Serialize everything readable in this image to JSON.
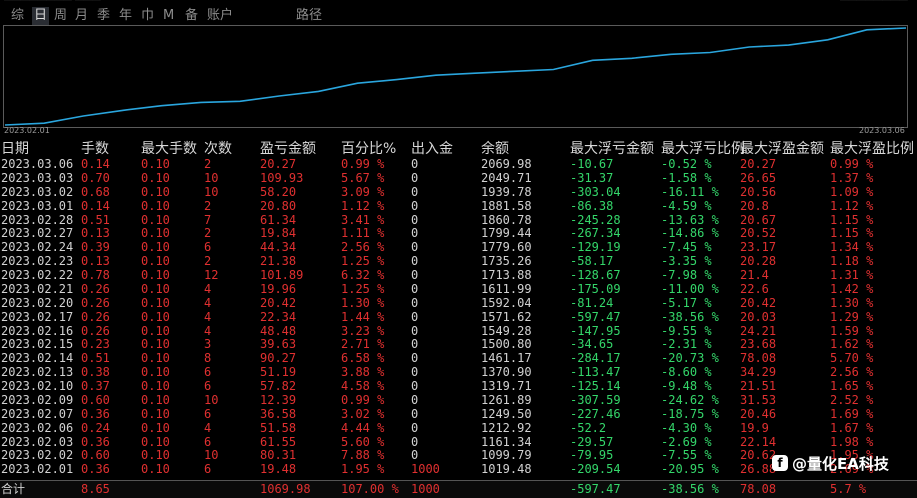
{
  "tabs": {
    "items": [
      "综",
      "日",
      "周",
      "月",
      "季",
      "年",
      "巾",
      "M",
      "备",
      "账户",
      "路径"
    ],
    "active_index": 1
  },
  "chart": {
    "start_date": "2023.02.01",
    "end_date": "2023.03.06",
    "line_color": "#2aa6de"
  },
  "columns": [
    "日期",
    "手数",
    "最大手数",
    "次数",
    "盈亏金额",
    "百分比%",
    "出入金",
    "余额",
    "最大浮亏金额",
    "最大浮亏比例",
    "最大浮盈金额",
    "最大浮盈比例"
  ],
  "colors": {
    "red": "#e03030",
    "green": "#34d66a",
    "white": "#d2d2d2"
  },
  "rows": [
    {
      "date": "2023.03.06",
      "lots": "0.14",
      "max_lots": "0.10",
      "count": "2",
      "pnl": "20.27",
      "pct": "0.99 %",
      "io": "0",
      "balance": "2069.98",
      "max_float_loss": "-10.67",
      "max_float_loss_pct": "-0.52 %",
      "max_float_profit": "20.27",
      "max_float_profit_pct": "0.99 %"
    },
    {
      "date": "2023.03.03",
      "lots": "0.70",
      "max_lots": "0.10",
      "count": "10",
      "pnl": "109.93",
      "pct": "5.67 %",
      "io": "0",
      "balance": "2049.71",
      "max_float_loss": "-31.37",
      "max_float_loss_pct": "-1.58 %",
      "max_float_profit": "26.65",
      "max_float_profit_pct": "1.37 %"
    },
    {
      "date": "2023.03.02",
      "lots": "0.68",
      "max_lots": "0.10",
      "count": "10",
      "pnl": "58.20",
      "pct": "3.09 %",
      "io": "0",
      "balance": "1939.78",
      "max_float_loss": "-303.04",
      "max_float_loss_pct": "-16.11 %",
      "max_float_profit": "20.56",
      "max_float_profit_pct": "1.09 %"
    },
    {
      "date": "2023.03.01",
      "lots": "0.14",
      "max_lots": "0.10",
      "count": "2",
      "pnl": "20.80",
      "pct": "1.12 %",
      "io": "0",
      "balance": "1881.58",
      "max_float_loss": "-86.38",
      "max_float_loss_pct": "-4.59 %",
      "max_float_profit": "20.8",
      "max_float_profit_pct": "1.12 %"
    },
    {
      "date": "2023.02.28",
      "lots": "0.51",
      "max_lots": "0.10",
      "count": "7",
      "pnl": "61.34",
      "pct": "3.41 %",
      "io": "0",
      "balance": "1860.78",
      "max_float_loss": "-245.28",
      "max_float_loss_pct": "-13.63 %",
      "max_float_profit": "20.67",
      "max_float_profit_pct": "1.15 %"
    },
    {
      "date": "2023.02.27",
      "lots": "0.13",
      "max_lots": "0.10",
      "count": "2",
      "pnl": "19.84",
      "pct": "1.11 %",
      "io": "0",
      "balance": "1799.44",
      "max_float_loss": "-267.34",
      "max_float_loss_pct": "-14.86 %",
      "max_float_profit": "20.52",
      "max_float_profit_pct": "1.15 %"
    },
    {
      "date": "2023.02.24",
      "lots": "0.39",
      "max_lots": "0.10",
      "count": "6",
      "pnl": "44.34",
      "pct": "2.56 %",
      "io": "0",
      "balance": "1779.60",
      "max_float_loss": "-129.19",
      "max_float_loss_pct": "-7.45 %",
      "max_float_profit": "23.17",
      "max_float_profit_pct": "1.34 %"
    },
    {
      "date": "2023.02.23",
      "lots": "0.13",
      "max_lots": "0.10",
      "count": "2",
      "pnl": "21.38",
      "pct": "1.25 %",
      "io": "0",
      "balance": "1735.26",
      "max_float_loss": "-58.17",
      "max_float_loss_pct": "-3.35 %",
      "max_float_profit": "20.28",
      "max_float_profit_pct": "1.18 %"
    },
    {
      "date": "2023.02.22",
      "lots": "0.78",
      "max_lots": "0.10",
      "count": "12",
      "pnl": "101.89",
      "pct": "6.32 %",
      "io": "0",
      "balance": "1713.88",
      "max_float_loss": "-128.67",
      "max_float_loss_pct": "-7.98 %",
      "max_float_profit": "21.4",
      "max_float_profit_pct": "1.31 %"
    },
    {
      "date": "2023.02.21",
      "lots": "0.26",
      "max_lots": "0.10",
      "count": "4",
      "pnl": "19.96",
      "pct": "1.25 %",
      "io": "0",
      "balance": "1611.99",
      "max_float_loss": "-175.09",
      "max_float_loss_pct": "-11.00 %",
      "max_float_profit": "22.6",
      "max_float_profit_pct": "1.42 %"
    },
    {
      "date": "2023.02.20",
      "lots": "0.26",
      "max_lots": "0.10",
      "count": "4",
      "pnl": "20.42",
      "pct": "1.30 %",
      "io": "0",
      "balance": "1592.04",
      "max_float_loss": "-81.24",
      "max_float_loss_pct": "-5.17 %",
      "max_float_profit": "20.42",
      "max_float_profit_pct": "1.30 %"
    },
    {
      "date": "2023.02.17",
      "lots": "0.26",
      "max_lots": "0.10",
      "count": "4",
      "pnl": "22.34",
      "pct": "1.44 %",
      "io": "0",
      "balance": "1571.62",
      "max_float_loss": "-597.47",
      "max_float_loss_pct": "-38.56 %",
      "max_float_profit": "20.03",
      "max_float_profit_pct": "1.29 %"
    },
    {
      "date": "2023.02.16",
      "lots": "0.26",
      "max_lots": "0.10",
      "count": "4",
      "pnl": "48.48",
      "pct": "3.23 %",
      "io": "0",
      "balance": "1549.28",
      "max_float_loss": "-147.95",
      "max_float_loss_pct": "-9.55 %",
      "max_float_profit": "24.21",
      "max_float_profit_pct": "1.59 %"
    },
    {
      "date": "2023.02.15",
      "lots": "0.23",
      "max_lots": "0.10",
      "count": "3",
      "pnl": "39.63",
      "pct": "2.71 %",
      "io": "0",
      "balance": "1500.80",
      "max_float_loss": "-34.65",
      "max_float_loss_pct": "-2.31 %",
      "max_float_profit": "23.68",
      "max_float_profit_pct": "1.62 %"
    },
    {
      "date": "2023.02.14",
      "lots": "0.51",
      "max_lots": "0.10",
      "count": "8",
      "pnl": "90.27",
      "pct": "6.58 %",
      "io": "0",
      "balance": "1461.17",
      "max_float_loss": "-284.17",
      "max_float_loss_pct": "-20.73 %",
      "max_float_profit": "78.08",
      "max_float_profit_pct": "5.70 %"
    },
    {
      "date": "2023.02.13",
      "lots": "0.38",
      "max_lots": "0.10",
      "count": "6",
      "pnl": "51.19",
      "pct": "3.88 %",
      "io": "0",
      "balance": "1370.90",
      "max_float_loss": "-113.47",
      "max_float_loss_pct": "-8.60 %",
      "max_float_profit": "34.29",
      "max_float_profit_pct": "2.56 %"
    },
    {
      "date": "2023.02.10",
      "lots": "0.37",
      "max_lots": "0.10",
      "count": "6",
      "pnl": "57.82",
      "pct": "4.58 %",
      "io": "0",
      "balance": "1319.71",
      "max_float_loss": "-125.14",
      "max_float_loss_pct": "-9.48 %",
      "max_float_profit": "21.51",
      "max_float_profit_pct": "1.65 %"
    },
    {
      "date": "2023.02.09",
      "lots": "0.60",
      "max_lots": "0.10",
      "count": "10",
      "pnl": "12.39",
      "pct": "0.99 %",
      "io": "0",
      "balance": "1261.89",
      "max_float_loss": "-307.59",
      "max_float_loss_pct": "-24.62 %",
      "max_float_profit": "31.53",
      "max_float_profit_pct": "2.52 %"
    },
    {
      "date": "2023.02.07",
      "lots": "0.36",
      "max_lots": "0.10",
      "count": "6",
      "pnl": "36.58",
      "pct": "3.02 %",
      "io": "0",
      "balance": "1249.50",
      "max_float_loss": "-227.46",
      "max_float_loss_pct": "-18.75 %",
      "max_float_profit": "20.46",
      "max_float_profit_pct": "1.69 %"
    },
    {
      "date": "2023.02.06",
      "lots": "0.24",
      "max_lots": "0.10",
      "count": "4",
      "pnl": "51.58",
      "pct": "4.44 %",
      "io": "0",
      "balance": "1212.92",
      "max_float_loss": "-52.2",
      "max_float_loss_pct": "-4.30 %",
      "max_float_profit": "19.9",
      "max_float_profit_pct": "1.67 %"
    },
    {
      "date": "2023.02.03",
      "lots": "0.36",
      "max_lots": "0.10",
      "count": "6",
      "pnl": "61.55",
      "pct": "5.60 %",
      "io": "0",
      "balance": "1161.34",
      "max_float_loss": "-29.57",
      "max_float_loss_pct": "-2.69 %",
      "max_float_profit": "22.14",
      "max_float_profit_pct": "1.98 %"
    },
    {
      "date": "2023.02.02",
      "lots": "0.60",
      "max_lots": "0.10",
      "count": "10",
      "pnl": "80.31",
      "pct": "7.88 %",
      "io": "0",
      "balance": "1099.79",
      "max_float_loss": "-79.95",
      "max_float_loss_pct": "-7.55 %",
      "max_float_profit": "20.62",
      "max_float_profit_pct": "1.95 %"
    },
    {
      "date": "2023.02.01",
      "lots": "0.36",
      "max_lots": "0.10",
      "count": "6",
      "pnl": "19.48",
      "pct": "1.95 %",
      "io": "1000",
      "balance": "1019.48",
      "max_float_loss": "-209.54",
      "max_float_loss_pct": "-20.95 %",
      "max_float_profit": "26.88",
      "max_float_profit_pct": "2.69 %"
    }
  ],
  "total": {
    "label": "合计",
    "lots": "8.65",
    "pnl": "1069.98",
    "pct": "107.00 %",
    "io": "1000",
    "max_float_loss": "-597.47",
    "max_float_loss_pct": "-38.56 %",
    "max_float_profit": "78.08",
    "max_float_profit_pct": "5.7 %"
  },
  "watermark": {
    "text": "@量化EA科技"
  }
}
